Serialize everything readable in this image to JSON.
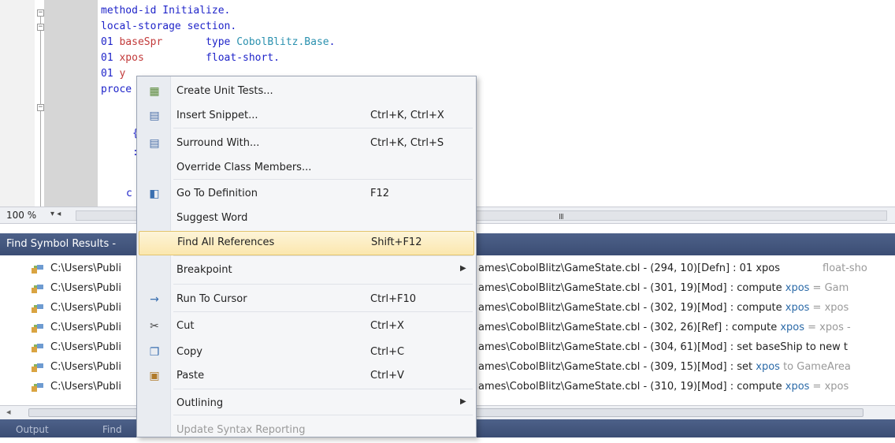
{
  "editor": {
    "lines": [
      {
        "parts": [
          {
            "t": "method-id Initialize.",
            "c": "kw"
          }
        ]
      },
      {
        "parts": [
          {
            "t": "local-storage section.",
            "c": "kw"
          }
        ]
      },
      {
        "parts": [
          {
            "t": "01 ",
            "c": "dk"
          },
          {
            "t": "baseSpr",
            "c": "nm"
          },
          {
            "t": "       type ",
            "c": "kw"
          },
          {
            "t": "CobolBlitz.Base",
            "c": "ty"
          },
          {
            "t": ".",
            "c": "kw"
          }
        ]
      },
      {
        "parts": [
          {
            "t": "01 ",
            "c": "dk"
          },
          {
            "t": "xpos",
            "c": "nm"
          },
          {
            "t": "          float-short.",
            "c": "kw"
          }
        ]
      },
      {
        "parts": [
          {
            "t": "01 ",
            "c": "dk"
          },
          {
            "t": "y",
            "c": "nm"
          }
        ]
      },
      {
        "parts": [
          {
            "t": "proce",
            "c": "kw"
          }
        ]
      }
    ],
    "zoom": "100 %",
    "scroll_grip": "III"
  },
  "panel": {
    "title": "Find Symbol Results -",
    "rows": [
      {
        "path": "C:\\Users\\Publi",
        "tail_pre": "ames\\CobolBlitz\\GameState.cbl - (294, 10)[Defn] : 01 xpos",
        "tail_x": "",
        "tail_post": "",
        "extra": "float-sho"
      },
      {
        "path": "C:\\Users\\Publi",
        "tail_pre": "ames\\CobolBlitz\\GameState.cbl - (301, 19)[Mod] : compute ",
        "tail_x": "xpos",
        "tail_post": " = Gam",
        "extra": ""
      },
      {
        "path": "C:\\Users\\Publi",
        "tail_pre": "ames\\CobolBlitz\\GameState.cbl - (302, 19)[Mod] : compute ",
        "tail_x": "xpos",
        "tail_post": " = xpos",
        "extra": ""
      },
      {
        "path": "C:\\Users\\Publi",
        "tail_pre": "ames\\CobolBlitz\\GameState.cbl - (302, 26)[Ref] : compute ",
        "tail_x": "xpos",
        "tail_post": " = xpos -",
        "extra": ""
      },
      {
        "path": "C:\\Users\\Publi",
        "tail_pre": "ames\\CobolBlitz\\GameState.cbl - (304, 61)[Mod] : set baseShip to new t",
        "tail_x": "",
        "tail_post": "",
        "extra": ""
      },
      {
        "path": "C:\\Users\\Publi",
        "tail_pre": "ames\\CobolBlitz\\GameState.cbl - (309, 15)[Mod] : set ",
        "tail_x": "xpos",
        "tail_post": " to GameArea",
        "extra": ""
      },
      {
        "path": "C:\\Users\\Publi",
        "tail_pre": "ames\\CobolBlitz\\GameState.cbl - (310, 19)[Mod] : compute ",
        "tail_x": "xpos",
        "tail_post": " = xpos",
        "extra": ""
      }
    ],
    "bottom_tabs": [
      "Output",
      "Find"
    ]
  },
  "menu": {
    "items": [
      {
        "label": "Create Unit Tests...",
        "key": "",
        "icon": "unit-test-icon",
        "glyph": "▦",
        "color": "#5b8a3a"
      },
      {
        "label": "Insert Snippet...",
        "key": "Ctrl+K, Ctrl+X",
        "icon": "snippet-icon",
        "glyph": "▤",
        "color": "#4a6fa8"
      },
      {
        "label": "Surround With...",
        "key": "Ctrl+K, Ctrl+S",
        "icon": "surround-icon",
        "glyph": "▤",
        "color": "#4a6fa8"
      },
      {
        "label": "Override Class Members...",
        "key": "",
        "icon": "",
        "glyph": "",
        "color": ""
      },
      {
        "label": "Go To Definition",
        "key": "F12",
        "icon": "goto-definition-icon",
        "glyph": "◧",
        "color": "#3a6fb0"
      },
      {
        "label": "Suggest Word",
        "key": "",
        "icon": "",
        "glyph": "",
        "color": ""
      },
      {
        "label": "Find All References",
        "key": "Shift+F12",
        "icon": "",
        "glyph": "",
        "color": ""
      },
      {
        "label": "Breakpoint",
        "key": "",
        "icon": "",
        "glyph": "",
        "color": "",
        "submenu": true
      },
      {
        "label": "Run To Cursor",
        "key": "Ctrl+F10",
        "icon": "run-to-cursor-icon",
        "glyph": "→",
        "color": "#3a6fb0"
      },
      {
        "label": "Cut",
        "key": "Ctrl+X",
        "icon": "cut-icon",
        "glyph": "✂",
        "color": "#444"
      },
      {
        "label": "Copy",
        "key": "Ctrl+C",
        "icon": "copy-icon",
        "glyph": "❐",
        "color": "#3a6fb0"
      },
      {
        "label": "Paste",
        "key": "Ctrl+V",
        "icon": "paste-icon",
        "glyph": "▣",
        "color": "#b07a2a"
      },
      {
        "label": "Outlining",
        "key": "",
        "icon": "",
        "glyph": "",
        "color": "",
        "submenu": true
      },
      {
        "label": "Update Syntax Reporting",
        "key": "",
        "icon": "",
        "glyph": "",
        "color": "",
        "disabled": true
      }
    ],
    "highlighted_index": 6
  }
}
